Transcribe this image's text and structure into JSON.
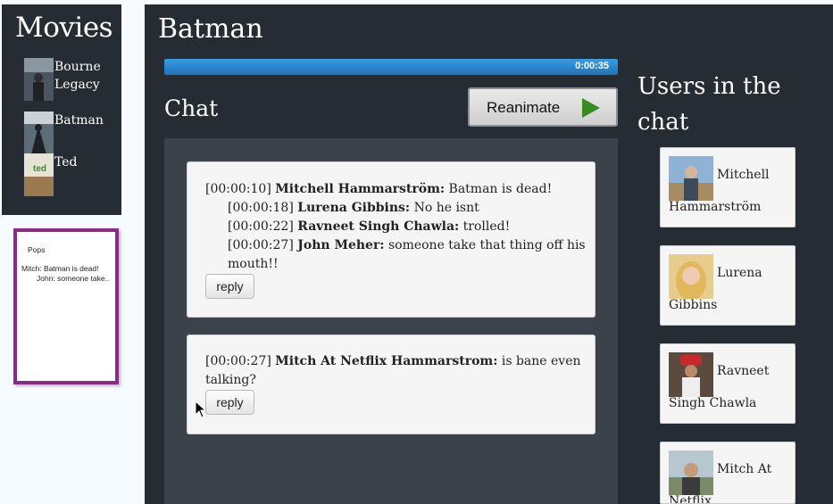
{
  "sidebar": {
    "title": "Movies",
    "movies": [
      {
        "label": "Bourne Legacy",
        "poster_icon": "bourne-legacy-poster"
      },
      {
        "label": "Batman",
        "poster_icon": "batman-poster"
      },
      {
        "label": "Ted",
        "poster_icon": "ted-poster",
        "poster_text": "ted"
      }
    ]
  },
  "pops": {
    "title": "Pops",
    "lines": [
      "Mitch: Batman is dead!",
      "John: someone take.."
    ]
  },
  "main": {
    "title": "Batman",
    "progress": {
      "time": "0:00:35",
      "fraction": 1.0
    },
    "chat_title": "Chat",
    "reanimate_label": "Reanimate",
    "reply_label": "reply",
    "threads": [
      {
        "messages": [
          {
            "time": "[00:00:10]",
            "user": "Mitchell Hammarström:",
            "text": "Batman is dead!"
          },
          {
            "time": "[00:00:18]",
            "user": "Lurena Gibbins:",
            "text": "No he isnt"
          },
          {
            "time": "[00:00:22]",
            "user": "Ravneet Singh Chawla:",
            "text": "trolled!"
          },
          {
            "time": "[00:00:27]",
            "user": "John Meher:",
            "text": "someone take that thing off his",
            "cont": "mouth!!"
          }
        ]
      },
      {
        "messages": [
          {
            "time": "[00:00:27]",
            "user": "Mitch At Netflix Hammarstrom:",
            "text": "is bane even",
            "cont": "talking?"
          }
        ]
      }
    ]
  },
  "users": {
    "title": "Users in the chat",
    "list": [
      {
        "first": "Mitchell",
        "rest": "Hammarström"
      },
      {
        "first": "Lurena",
        "rest": "Gibbins"
      },
      {
        "first": "Ravneet",
        "rest": "Singh Chawla"
      },
      {
        "first": "Mitch At",
        "rest": "Netflix"
      }
    ]
  },
  "colors": {
    "panel_bg": "#262c33",
    "chat_bg": "#3b424a",
    "progress": "#2b86cc",
    "pops_border": "#8c2a8c",
    "play": "#3a8a22"
  }
}
